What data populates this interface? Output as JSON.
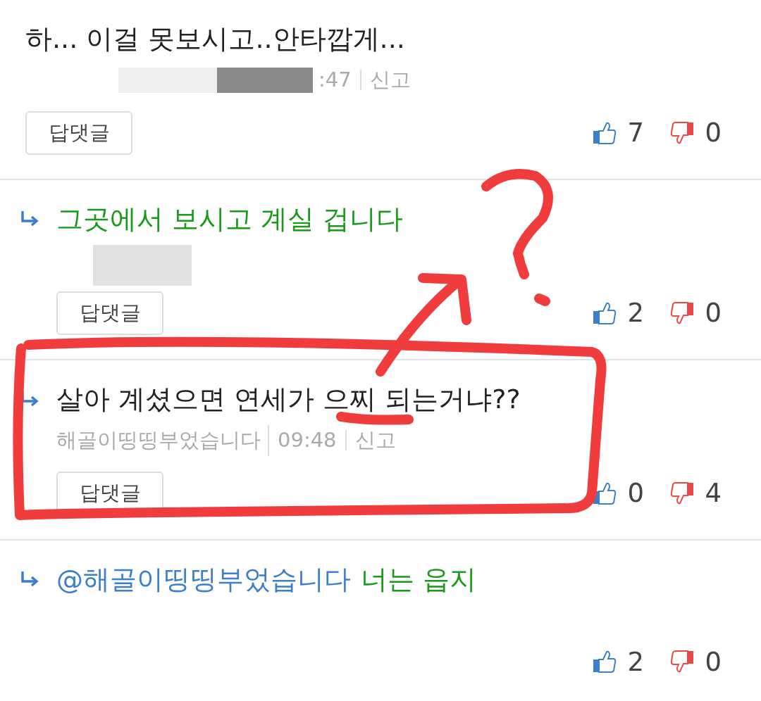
{
  "comments": [
    {
      "is_reply": false,
      "parts": [
        {
          "kind": "plain",
          "text": "하... 이걸 못보시고..안타깝게..."
        }
      ],
      "author_redacted": true,
      "time": ":47",
      "report": "신고",
      "reply_button": "답댓글",
      "likes": "7",
      "dislikes": "0"
    },
    {
      "is_reply": true,
      "parts": [
        {
          "kind": "green",
          "text": "그곳에서 보시고 계실 겁니다"
        }
      ],
      "author_redacted": true,
      "reply_button": "답댓글",
      "likes": "2",
      "dislikes": "0"
    },
    {
      "is_reply": true,
      "parts": [
        {
          "kind": "plain",
          "text": "살아 계셨으면 연세가 으찌 되는거냐??"
        }
      ],
      "author": "해골이띵띵부었습니다",
      "time": "09:48",
      "report": "신고",
      "reply_button": "답댓글",
      "likes": "0",
      "dislikes": "4"
    },
    {
      "is_reply": true,
      "parts": [
        {
          "kind": "mention",
          "text": "@해골이띵띵부었습니다"
        },
        {
          "kind": "green",
          "text": "너는 읍지"
        }
      ],
      "likes": "2",
      "dislikes": "0"
    }
  ]
}
